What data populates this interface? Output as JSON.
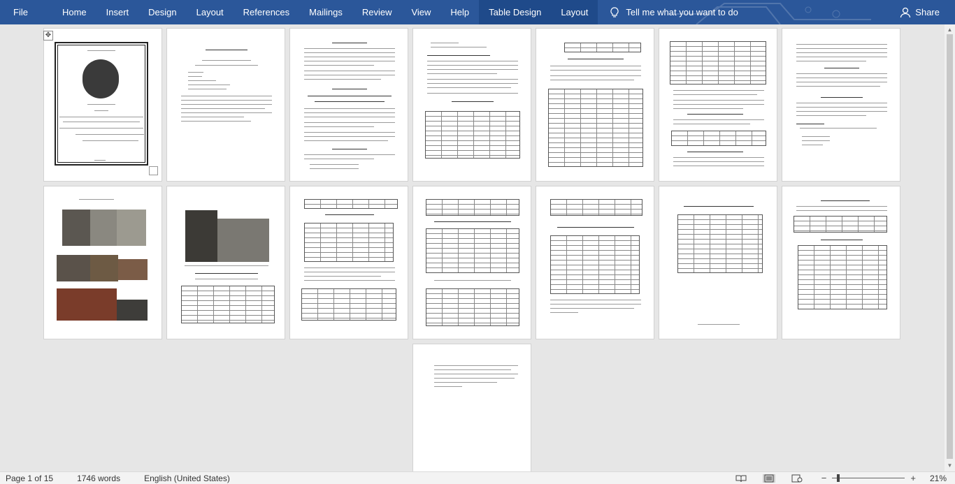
{
  "ribbon": {
    "tabs": [
      "File",
      "Home",
      "Insert",
      "Design",
      "Layout",
      "References",
      "Mailings",
      "Review",
      "View",
      "Help",
      "Table Design",
      "Layout"
    ],
    "tell_me": "Tell me what you want to do",
    "share": "Share"
  },
  "status": {
    "page": "Page 1 of 15",
    "words": "1746 words",
    "language": "English (United States)",
    "zoom": "21%",
    "zoom_fraction": 0.21
  },
  "colors": {
    "ribbon": "#2b579a",
    "canvas": "#e6e6e6",
    "statusbar": "#f3f3f3"
  },
  "icons": [
    "table-move-handle-icon",
    "lightbulb-icon",
    "person-icon",
    "read-mode-icon",
    "print-layout-icon",
    "web-layout-icon"
  ]
}
